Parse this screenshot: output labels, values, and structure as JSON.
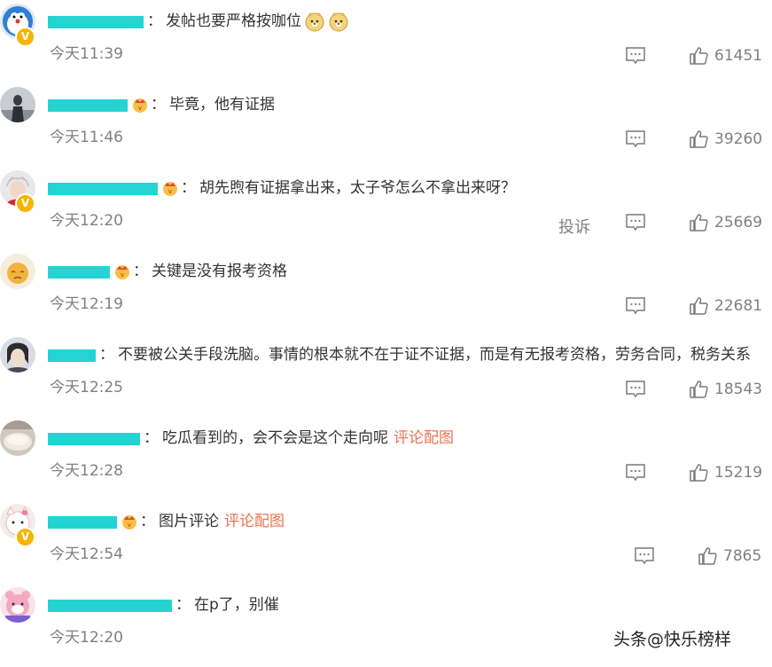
{
  "comments": [
    {
      "username": "",
      "text": "发帖也要严格按咖位",
      "link": "",
      "emojis": [
        "doge-emoji",
        "doge-emoji"
      ],
      "crown": false,
      "verified": true,
      "time": "今天11:39",
      "report": "",
      "likes": "61451"
    },
    {
      "username": "",
      "text": "毕竟，他有证据",
      "link": "",
      "emojis": [],
      "crown": true,
      "verified": false,
      "time": "今天11:46",
      "report": "",
      "likes": "39260"
    },
    {
      "username": "",
      "text": "胡先煦有证据拿出来，太子爷怎么不拿出来呀？",
      "link": "",
      "emojis": [],
      "crown": true,
      "verified": true,
      "time": "今天12:20",
      "report": "投诉",
      "likes": "25669"
    },
    {
      "username": "",
      "text": "关键是没有报考资格",
      "link": "",
      "emojis": [],
      "crown": true,
      "verified": false,
      "time": "今天12:19",
      "report": "",
      "likes": "22681"
    },
    {
      "username": "",
      "text": "不要被公关手段洗脑。事情的根本就不在于证不证据，而是有无报考资格，劳务合同，税务关系",
      "link": "",
      "emojis": [],
      "crown": false,
      "verified": false,
      "time": "今天12:25",
      "report": "",
      "likes": "18543"
    },
    {
      "username": "",
      "text": "吃瓜看到的，会不会是这个走向呢",
      "link": "评论配图",
      "emojis": [],
      "crown": false,
      "verified": false,
      "time": "今天12:28",
      "report": "",
      "likes": "15219"
    },
    {
      "username": "",
      "text": "图片评论",
      "link": "评论配图",
      "emojis": [],
      "crown": true,
      "verified": true,
      "time": "今天12:54",
      "report": "",
      "likes": "7865"
    },
    {
      "username": "",
      "text": "在p了，别催",
      "link": "",
      "emojis": [],
      "crown": false,
      "verified": false,
      "time": "今天12:20",
      "report": "",
      "likes": ""
    }
  ],
  "colon": "：",
  "watermark": "头条@快乐榜样",
  "colors": {
    "accent": "#eb7350",
    "redaction": "#26d3d3",
    "badge": "#f4b400",
    "meta": "#808080"
  }
}
